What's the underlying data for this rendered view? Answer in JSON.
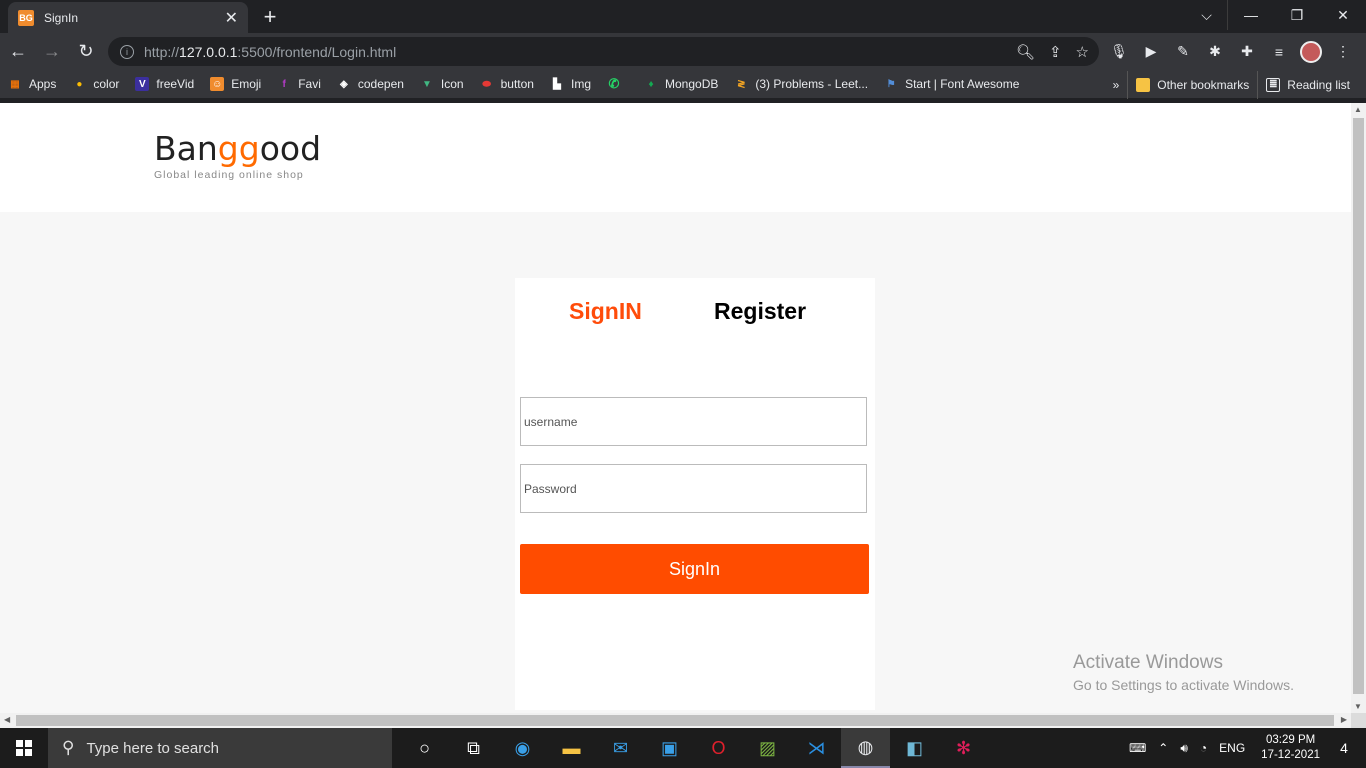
{
  "browser": {
    "tab_title": "SignIn",
    "tab_favicon": "BG",
    "url_prefix": "http://",
    "url_host": "127.0.0.1",
    "url_rest": ":5500/frontend/Login.html"
  },
  "bookmarks": {
    "items": [
      {
        "label": "Apps",
        "icon": "apps-grid-icon",
        "color": "#e8710a"
      },
      {
        "label": "color",
        "icon": "color-icon",
        "color": "#fbbc04"
      },
      {
        "label": "freeVid",
        "icon": "freevid-icon",
        "color": "#5b4bd6"
      },
      {
        "label": "Emoji",
        "icon": "emoji-icon",
        "color": "#f08c2e"
      },
      {
        "label": "Favi",
        "icon": "favi-icon",
        "color": "#b43cc8"
      },
      {
        "label": "codepen",
        "icon": "codepen-icon",
        "color": "#ffffff"
      },
      {
        "label": "Icon",
        "icon": "vue-icon",
        "color": "#41b883"
      },
      {
        "label": "button",
        "icon": "button-icon",
        "color": "#e53935"
      },
      {
        "label": "Img",
        "icon": "img-icon",
        "color": "#ffffff"
      },
      {
        "label": "",
        "icon": "whatsapp-icon",
        "color": "#25d366"
      },
      {
        "label": "MongoDB",
        "icon": "mongodb-icon",
        "color": "#13aa52"
      },
      {
        "label": "(3) Problems - Leet...",
        "icon": "leetcode-icon",
        "color": "#f5a623"
      },
      {
        "label": "Start | Font Awesome",
        "icon": "fontawesome-icon",
        "color": "#528dd7"
      }
    ],
    "overflow": "»",
    "other": "Other bookmarks",
    "reading": "Reading list"
  },
  "page": {
    "logo_pre": "Ban",
    "logo_gg": "gg",
    "logo_post": "ood",
    "tagline": "Global leading online shop",
    "tab_signin": "SignIN",
    "tab_register": "Register",
    "username_placeholder": "username",
    "password_placeholder": "Password",
    "submit_label": "SignIn",
    "accent_color": "#ff4c00"
  },
  "watermark": {
    "line1": "Activate Windows",
    "line2": "Go to Settings to activate Windows."
  },
  "taskbar": {
    "search_placeholder": "Type here to search",
    "lang": "ENG",
    "time": "03:29 PM",
    "date": "17-12-2021",
    "notification_count": "4"
  }
}
